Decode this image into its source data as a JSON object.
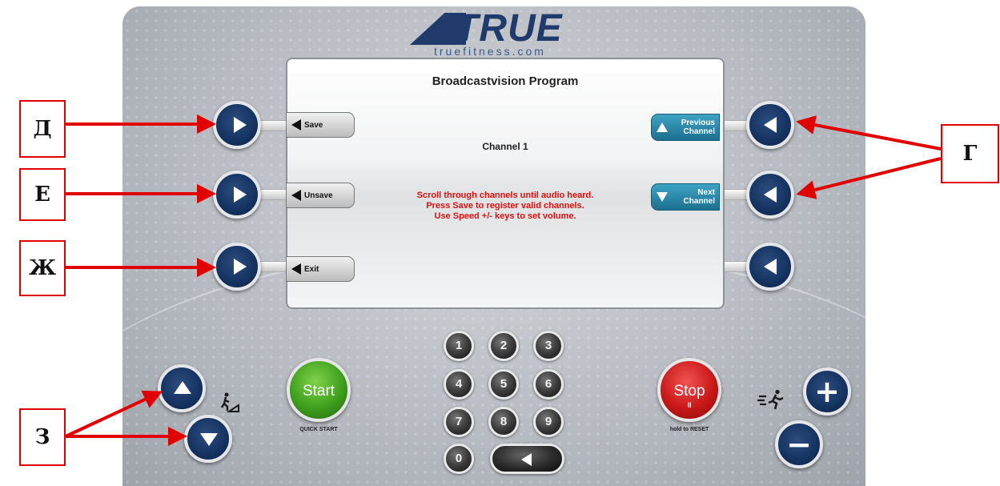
{
  "logo": {
    "brand": "TRUE",
    "url": "truefitness.com"
  },
  "screen": {
    "title": "Broadcastvision Program",
    "channel": "Channel 1",
    "message_lines": [
      "Scroll through channels until audio heard.",
      "Press Save to register valid channels.",
      "Use Speed +/- keys to set volume."
    ],
    "left_softkeys": [
      "Save",
      "Unsave",
      "Exit"
    ],
    "right_softkeys": [
      {
        "line1": "Previous",
        "line2": "Channel",
        "icon": "triangle-up-icon"
      },
      {
        "line1": "Next",
        "line2": "Channel",
        "icon": "triangle-down-icon"
      }
    ]
  },
  "keypad": {
    "keys": [
      "1",
      "2",
      "3",
      "4",
      "5",
      "6",
      "7",
      "8",
      "9",
      "0"
    ],
    "back_icon": "arrow-left-icon"
  },
  "start": {
    "label": "Start",
    "sub": "QUICK START"
  },
  "stop": {
    "label": "Stop",
    "pause": "II",
    "sub": "hold to RESET"
  },
  "speed": {
    "plus": "+",
    "minus": "−"
  },
  "annotations": {
    "d": "Д",
    "e": "Е",
    "zh": "Ж",
    "g": "Г",
    "z": "З"
  },
  "colors": {
    "button_navy": "#163563",
    "annotation_red": "#e00000",
    "message_red": "#e01010",
    "softkey_teal": "#2a88ab"
  }
}
